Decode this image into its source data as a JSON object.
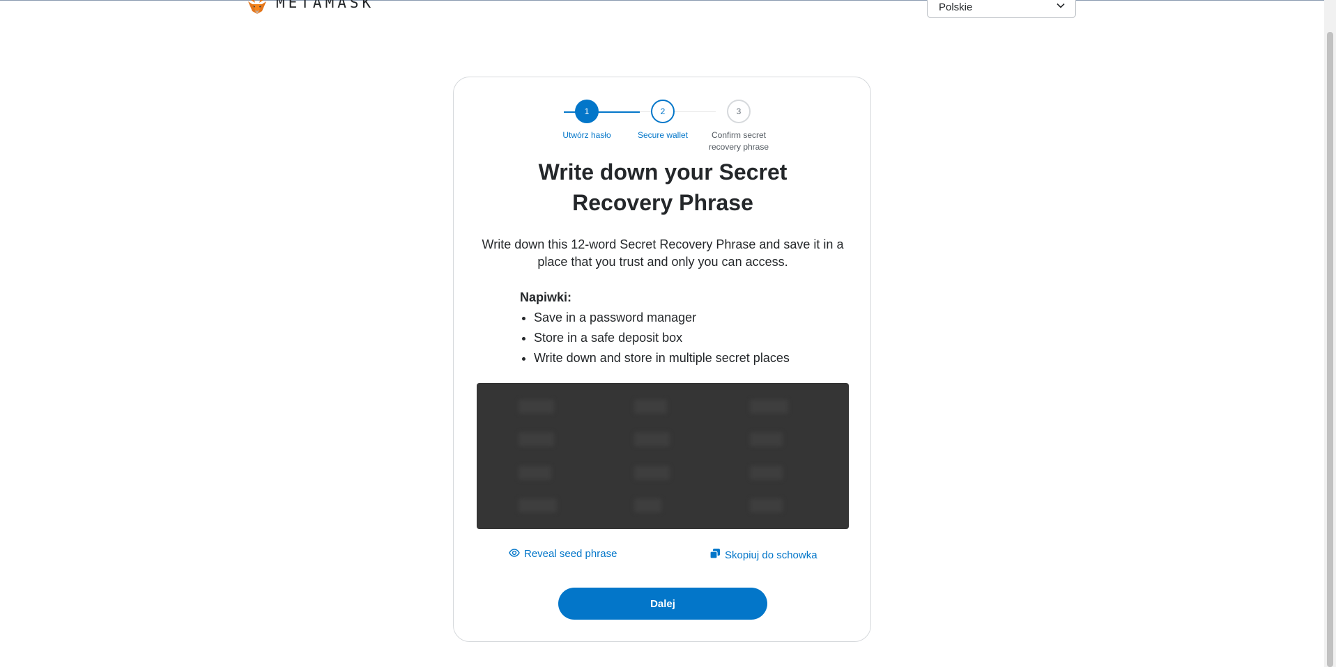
{
  "header": {
    "brand": "METAMASK",
    "language_selected": "Polskie",
    "icons": [
      "metamask-fox-icon",
      "chevron-down-icon"
    ]
  },
  "stepper": {
    "steps": [
      {
        "number": "1",
        "label": "Utwórz hasło",
        "state": "complete"
      },
      {
        "number": "2",
        "label": "Secure wallet",
        "state": "active"
      },
      {
        "number": "3",
        "label": "Confirm secret recovery phrase",
        "state": "pending"
      }
    ]
  },
  "main": {
    "title": "Write down your Secret Recovery Phrase",
    "description": "Write down this 12-word Secret Recovery Phrase and save it in a place that you trust and only you can access.",
    "tips_title": "Napiwki:",
    "tips": [
      "Save in a password manager",
      "Store in a safe deposit box",
      "Write down and store in multiple secret places"
    ]
  },
  "actions": {
    "reveal_label": "Reveal seed phrase",
    "copy_label": "Skopiuj do schowka",
    "next_label": "Dalej"
  },
  "colors": {
    "accent": "#0376c9",
    "text": "#24272a",
    "phrase_box": "#353535",
    "pending": "#bbc0c5"
  }
}
